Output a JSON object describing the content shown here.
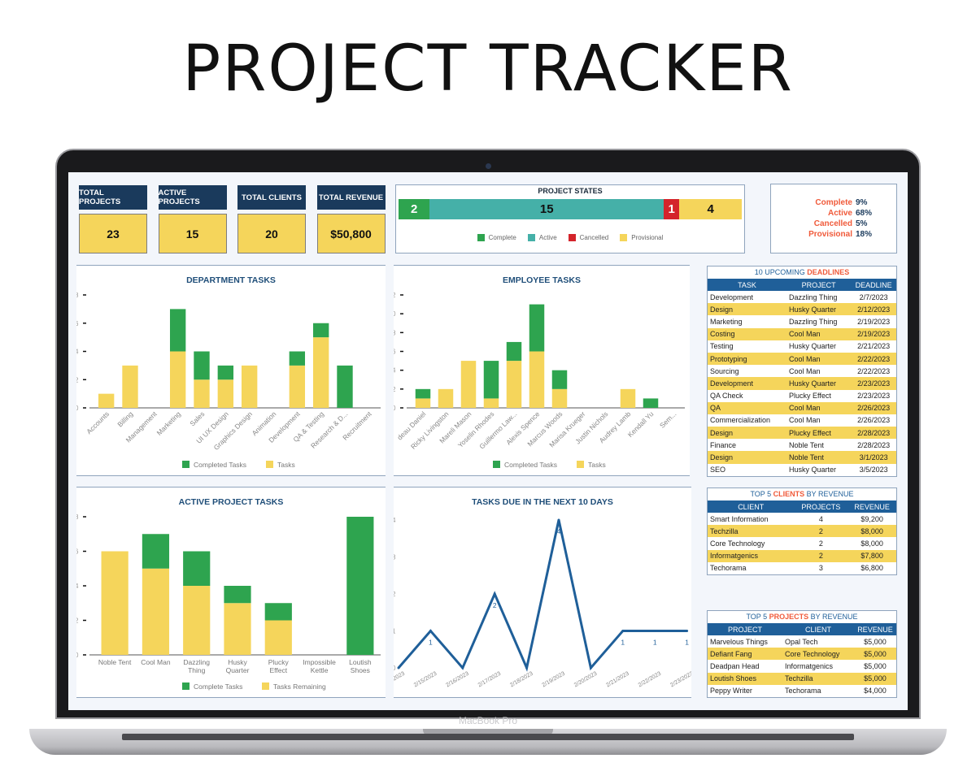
{
  "page_title": "PROJECT TRACKER",
  "device_label": "MacBook Pro",
  "colors": {
    "navy": "#1a3a5c",
    "yellow": "#f5d55b",
    "green": "#2ea44f",
    "teal": "#45b0a8",
    "red": "#d4242b",
    "table_header": "#1f5f99",
    "accent": "#f05a3a"
  },
  "kpis": [
    {
      "label": "TOTAL PROJECTS",
      "value": "23"
    },
    {
      "label": "ACTIVE PROJECTS",
      "value": "15"
    },
    {
      "label": "TOTAL CLIENTS",
      "value": "20"
    },
    {
      "label": "TOTAL REVENUE",
      "value": "$50,800"
    }
  ],
  "project_states": {
    "title": "PROJECT STATES",
    "segments": [
      {
        "name": "Complete",
        "value": 2,
        "color": "#2ea44f"
      },
      {
        "name": "Active",
        "value": 15,
        "color": "#45b0a8"
      },
      {
        "name": "Cancelled",
        "value": 1,
        "color": "#d4242b"
      },
      {
        "name": "Provisional",
        "value": 4,
        "color": "#f5d55b"
      }
    ]
  },
  "state_percentages": [
    {
      "label": "Complete",
      "value": "9%"
    },
    {
      "label": "Active",
      "value": "68%"
    },
    {
      "label": "Cancelled",
      "value": "5%"
    },
    {
      "label": "Provisional",
      "value": "18%"
    }
  ],
  "chart_data": [
    {
      "id": "dept",
      "type": "bar",
      "stacked": true,
      "title": "DEPARTMENT TASKS",
      "ylim": [
        0,
        8
      ],
      "yticks": [
        0,
        2,
        4,
        6,
        8
      ],
      "categories": [
        "Accounts",
        "Billing",
        "Management",
        "Marketing",
        "Sales",
        "UI UX Design",
        "Graphics Design",
        "Animation",
        "Development",
        "QA & Testing",
        "Research & D...",
        "Recruitment"
      ],
      "series": [
        {
          "name": "Tasks",
          "color": "#f5d55b",
          "values": [
            1,
            3,
            0,
            4,
            2,
            2,
            3,
            0,
            3,
            5,
            0,
            0
          ]
        },
        {
          "name": "Completed Tasks",
          "color": "#2ea44f",
          "values": [
            0,
            0,
            0,
            3,
            2,
            1,
            0,
            0,
            1,
            1,
            3,
            0
          ]
        }
      ],
      "legend": [
        "Completed Tasks",
        "Tasks"
      ],
      "label_rotate": true
    },
    {
      "id": "emp",
      "type": "bar",
      "stacked": true,
      "title": "EMPLOYEE TASKS",
      "ylim": [
        0,
        12
      ],
      "yticks": [
        0,
        2,
        4,
        6,
        8,
        10,
        12
      ],
      "categories": [
        "deau Daniel",
        "Ricky Livingston",
        "Mareli Mason",
        "Yoselin Rhodes",
        "Guillermo Law...",
        "Alexis Spence",
        "Marcus Woods",
        "Marisa Krueger",
        "Justin Nichols",
        "Audrey Lamb",
        "Kendall Yu",
        "Sem..."
      ],
      "series": [
        {
          "name": "Tasks",
          "color": "#f5d55b",
          "values": [
            1,
            2,
            5,
            1,
            5,
            6,
            2,
            0,
            0,
            2,
            0,
            0
          ]
        },
        {
          "name": "Completed Tasks",
          "color": "#2ea44f",
          "values": [
            1,
            0,
            0,
            4,
            2,
            5,
            2,
            0,
            0,
            0,
            1,
            0
          ]
        }
      ],
      "legend": [
        "Completed Tasks",
        "Tasks"
      ],
      "label_rotate": true
    },
    {
      "id": "active",
      "type": "bar",
      "stacked": true,
      "title": "ACTIVE PROJECT TASKS",
      "ylim": [
        0,
        8
      ],
      "yticks": [
        0,
        2,
        4,
        6,
        8
      ],
      "categories": [
        "Noble Tent",
        "Cool Man",
        "Dazzling Thing",
        "Husky Quarter",
        "Plucky Effect",
        "Impossible Kettle",
        "Loutish Shoes"
      ],
      "series": [
        {
          "name": "Tasks Remaining",
          "color": "#f5d55b",
          "values": [
            6,
            5,
            4,
            3,
            2,
            0,
            0
          ]
        },
        {
          "name": "Complete Tasks",
          "color": "#2ea44f",
          "values": [
            0,
            2,
            2,
            1,
            1,
            0,
            8
          ]
        }
      ],
      "legend": [
        "Complete Tasks",
        "Tasks Remaining"
      ],
      "label_rotate": false
    },
    {
      "id": "due",
      "type": "line",
      "title": "TASKS DUE IN THE NEXT 10 DAYS",
      "ylim": [
        0,
        4
      ],
      "yticks": [
        0,
        1,
        2,
        3,
        4
      ],
      "x": [
        "2/14/2023",
        "2/15/2023",
        "2/16/2023",
        "2/17/2023",
        "2/18/2023",
        "2/19/2023",
        "2/20/2023",
        "2/21/2023",
        "2/22/2023",
        "2/23/2023"
      ],
      "values": [
        0,
        1,
        0,
        2,
        0,
        4,
        0,
        1,
        1,
        1
      ],
      "color": "#1f5f99",
      "data_labels": true
    }
  ],
  "deadlines": {
    "title_pre": "10 UPCOMING ",
    "title_hl": "DEADLINES",
    "columns": [
      "TASK",
      "PROJECT",
      "DEADLINE"
    ],
    "rows": [
      [
        "Development",
        "Dazzling Thing",
        "2/7/2023"
      ],
      [
        "Design",
        "Husky Quarter",
        "2/12/2023"
      ],
      [
        "Marketing",
        "Dazzling Thing",
        "2/19/2023"
      ],
      [
        "Costing",
        "Cool Man",
        "2/19/2023"
      ],
      [
        "Testing",
        "Husky Quarter",
        "2/21/2023"
      ],
      [
        "Prototyping",
        "Cool Man",
        "2/22/2023"
      ],
      [
        "Sourcing",
        "Cool Man",
        "2/22/2023"
      ],
      [
        "Development",
        "Husky Quarter",
        "2/23/2023"
      ],
      [
        "QA Check",
        "Plucky Effect",
        "2/23/2023"
      ],
      [
        "QA",
        "Cool Man",
        "2/26/2023"
      ],
      [
        "Commercialization",
        "Cool Man",
        "2/26/2023"
      ],
      [
        "Design",
        "Plucky Effect",
        "2/28/2023"
      ],
      [
        "Finance",
        "Noble Tent",
        "2/28/2023"
      ],
      [
        "Design",
        "Noble Tent",
        "3/1/2023"
      ],
      [
        "SEO",
        "Husky Quarter",
        "3/5/2023"
      ]
    ]
  },
  "top_clients": {
    "title_pre": "TOP 5 ",
    "title_hl": "CLIENTS",
    "title_post": " BY REVENUE",
    "columns": [
      "CLIENT",
      "PROJECTS",
      "REVENUE"
    ],
    "rows": [
      [
        "Smart Information",
        "4",
        "$9,200"
      ],
      [
        "Techzilla",
        "2",
        "$8,000"
      ],
      [
        "Core Technology",
        "2",
        "$8,000"
      ],
      [
        "Informatgenics",
        "2",
        "$7,800"
      ],
      [
        "Techorama",
        "3",
        "$6,800"
      ]
    ]
  },
  "top_projects": {
    "title_pre": "TOP 5 ",
    "title_hl": "PROJECTS",
    "title_post": " BY REVENUE",
    "columns": [
      "PROJECT",
      "CLIENT",
      "REVENUE"
    ],
    "rows": [
      [
        "Marvelous Things",
        "Opal Tech",
        "$5,000"
      ],
      [
        "Defiant Fang",
        "Core Technology",
        "$5,000"
      ],
      [
        "Deadpan Head",
        "Informatgenics",
        "$5,000"
      ],
      [
        "Loutish Shoes",
        "Techzilla",
        "$5,000"
      ],
      [
        "Peppy Writer",
        "Techorama",
        "$4,000"
      ]
    ]
  }
}
